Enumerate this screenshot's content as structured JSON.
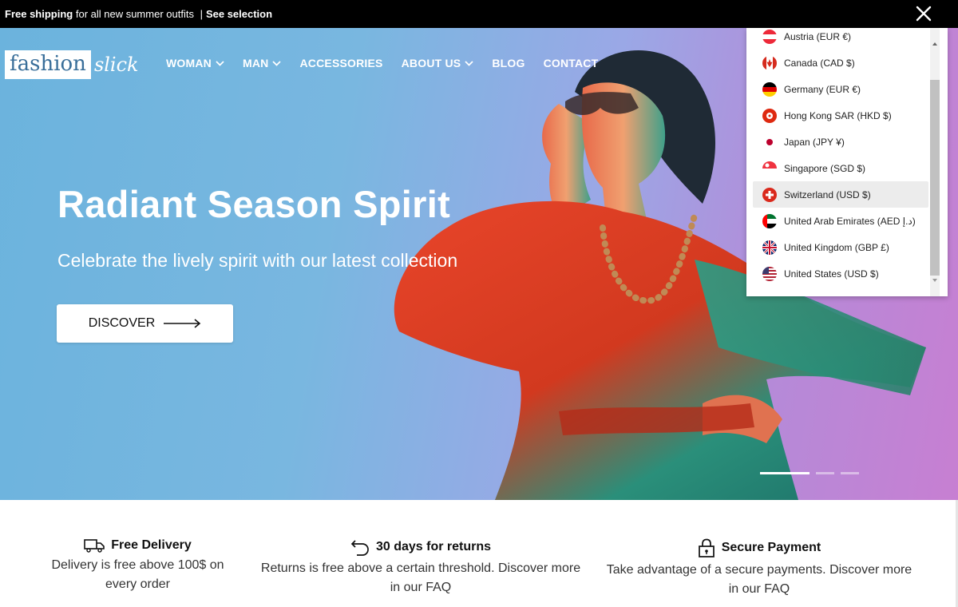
{
  "announcement": {
    "bold_lead": "Free shipping",
    "text": " for all new summer outfits ",
    "separator": "|",
    "link": "See selection"
  },
  "header": {
    "logo_box": "fashion",
    "logo_script": "slick",
    "nav": [
      {
        "label": "WOMAN",
        "has_dropdown": true
      },
      {
        "label": "MAN",
        "has_dropdown": true
      },
      {
        "label": "ACCESSORIES",
        "has_dropdown": false
      },
      {
        "label": "ABOUT US",
        "has_dropdown": true
      },
      {
        "label": "BLOG",
        "has_dropdown": false
      },
      {
        "label": "CONTACT",
        "has_dropdown": false
      }
    ]
  },
  "hero": {
    "title": "Radiant Season Spirit",
    "subtitle": "Celebrate the lively spirit with our latest collection",
    "cta": "DISCOVER",
    "slides_total": 3,
    "active_slide": 1
  },
  "currency_dropdown": {
    "items": [
      {
        "label": "Austria (EUR €)",
        "flag": "austria-flag"
      },
      {
        "label": "Canada (CAD $)",
        "flag": "canada-flag"
      },
      {
        "label": "Germany (EUR €)",
        "flag": "germany-flag"
      },
      {
        "label": "Hong Kong SAR (HKD $)",
        "flag": "hong-kong-flag"
      },
      {
        "label": "Japan (JPY ¥)",
        "flag": "japan-flag"
      },
      {
        "label": "Singapore (SGD $)",
        "flag": "singapore-flag"
      },
      {
        "label": "Switzerland (USD $)",
        "flag": "switzerland-flag",
        "highlighted": true
      },
      {
        "label": "United Arab Emirates (AED د.إ)",
        "flag": "uae-flag"
      },
      {
        "label": "United Kingdom (GBP £)",
        "flag": "uk-flag"
      },
      {
        "label": "United States (USD $)",
        "flag": "us-flag"
      }
    ]
  },
  "features": [
    {
      "icon": "truck-icon",
      "title": "Free Delivery",
      "line1": "Delivery is free above 100$ on",
      "line2": "every order"
    },
    {
      "icon": "return-arrow-icon",
      "title": "30 days for returns",
      "line1": "Returns is free above a certain threshold. Discover more",
      "line2": "in our FAQ"
    },
    {
      "icon": "lock-icon",
      "title": "Secure Payment",
      "line1": "Take advantage of a secure payments. Discover more",
      "line2": "in our FAQ"
    }
  ],
  "colors": {
    "topbar": "#000000",
    "hero_left": "#6bb3dd",
    "hero_right": "#c77fd2",
    "logo_text": "#3a6f9a",
    "dropdown_highlight": "#ececec"
  }
}
